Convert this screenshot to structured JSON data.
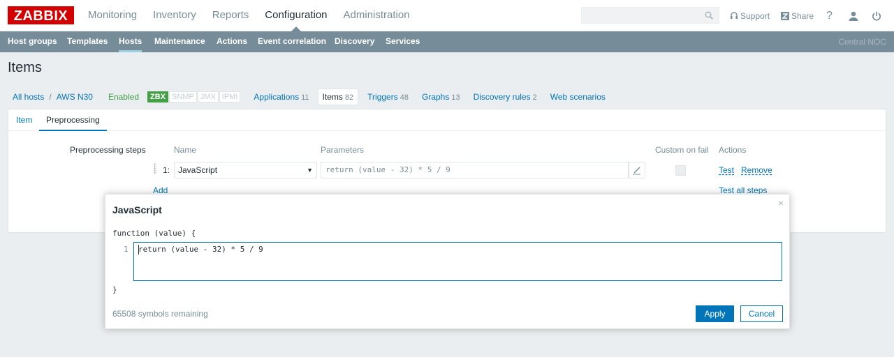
{
  "logo": "ZABBIX",
  "main_nav": [
    "Monitoring",
    "Inventory",
    "Reports",
    "Configuration",
    "Administration"
  ],
  "main_nav_selected": "Configuration",
  "top_links": {
    "support": "Support",
    "share": "Share",
    "help": "?"
  },
  "sub_nav": [
    "Host groups",
    "Templates",
    "Hosts",
    "Maintenance",
    "Actions",
    "Event correlation",
    "Discovery",
    "Services"
  ],
  "sub_nav_selected": "Hosts",
  "server_name": "Central NOC",
  "page_title": "Items",
  "breadcrumbs": {
    "all_hosts": "All hosts",
    "separator": "/",
    "host": "AWS N30",
    "status": "Enabled",
    "availability": [
      "ZBX",
      "SNMP",
      "JMX",
      "IPMI"
    ],
    "applications": {
      "label": "Applications",
      "count": "11"
    },
    "items": {
      "label": "Items",
      "count": "82"
    },
    "triggers": {
      "label": "Triggers",
      "count": "48"
    },
    "graphs": {
      "label": "Graphs",
      "count": "13"
    },
    "discovery": {
      "label": "Discovery rules",
      "count": "2"
    },
    "web": {
      "label": "Web scenarios"
    }
  },
  "form_tabs": [
    "Item",
    "Preprocessing"
  ],
  "preprocessing": {
    "section_label": "Preprocessing steps",
    "col_name": "Name",
    "col_params": "Parameters",
    "col_custom": "Custom on fail",
    "col_actions": "Actions",
    "step_number": "1:",
    "step_name": "JavaScript",
    "step_param": "return (value - 32) * 5 / 9",
    "test": "Test",
    "remove": "Remove",
    "add": "Add",
    "test_all": "Test all steps"
  },
  "dialog": {
    "title": "JavaScript",
    "close": "×",
    "func_open": "function (value) {",
    "line_no": "1",
    "code": "return (value - 32) * 5 / 9",
    "func_close": "}",
    "remaining": "65508 symbols remaining",
    "apply": "Apply",
    "cancel": "Cancel"
  },
  "colors": {
    "brand": "#d40000",
    "nav": "#768d99",
    "link": "#0275b8",
    "enabled": "#429e47"
  }
}
